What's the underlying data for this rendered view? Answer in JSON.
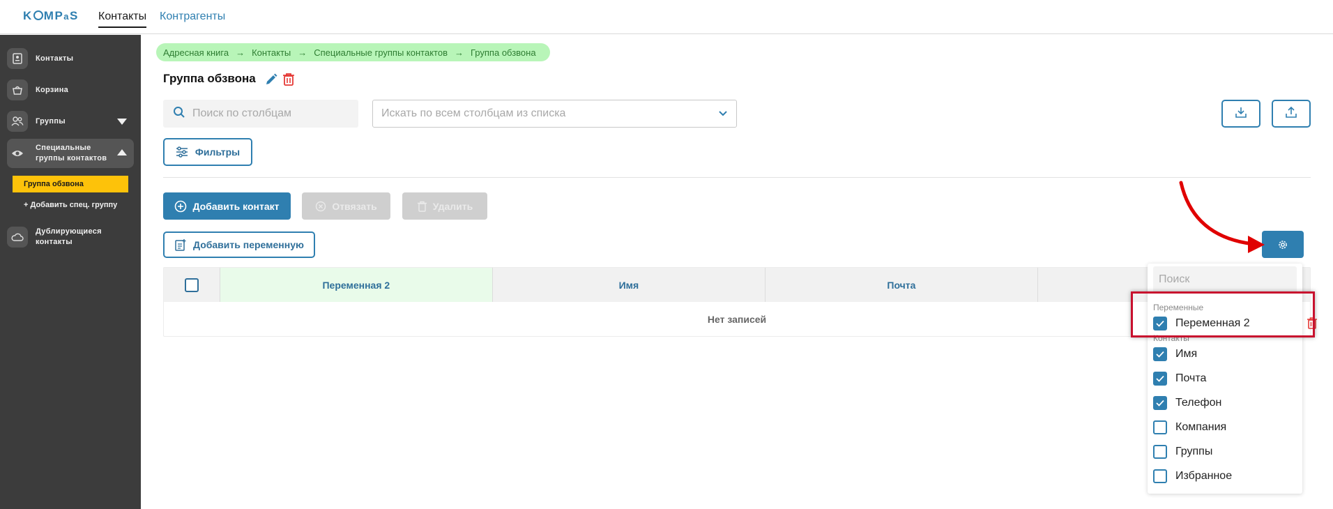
{
  "app": {
    "logo": "KOMPAS",
    "top_tabs": [
      {
        "label": "Контакты",
        "active": true
      },
      {
        "label": "Контрагенты",
        "active": false
      }
    ]
  },
  "sidebar": {
    "items": [
      {
        "label": "Контакты",
        "icon": "contact-card-icon"
      },
      {
        "label": "Корзина",
        "icon": "basket-icon"
      },
      {
        "label": "Группы",
        "icon": "users-icon"
      },
      {
        "label": "Специальные группы контактов",
        "icon": "eye-icon"
      },
      {
        "label": "Дублирующиеся контакты",
        "icon": "cloud-icon"
      }
    ],
    "sub_active": "Группа обзвона",
    "sub_add": "+ Добавить спец. группу"
  },
  "breadcrumb": [
    "Адресная книга",
    "Контакты",
    "Специальные группы контактов",
    "Группа обзвона"
  ],
  "page_title": "Группа обзвона",
  "search": {
    "columns_placeholder": "Поиск по столбцам",
    "all_placeholder": "Искать по всем столбцам из списка"
  },
  "buttons": {
    "filters": "Фильтры",
    "add_contact": "Добавить контакт",
    "unlink": "Отвязать",
    "delete": "Удалить",
    "add_variable": "Добавить переменную"
  },
  "table": {
    "columns": [
      "Переменная 2",
      "Имя",
      "Почта",
      ""
    ],
    "empty_text": "Нет записей"
  },
  "column_panel": {
    "search_placeholder": "Поиск",
    "groups": [
      {
        "label": "Переменные",
        "options": [
          {
            "label": "Переменная 2",
            "checked": true
          }
        ]
      },
      {
        "label": "Контакты",
        "options": [
          {
            "label": "Имя",
            "checked": true
          },
          {
            "label": "Почта",
            "checked": true
          },
          {
            "label": "Телефон",
            "checked": true
          },
          {
            "label": "Компания",
            "checked": false
          },
          {
            "label": "Группы",
            "checked": false
          },
          {
            "label": "Избранное",
            "checked": false
          }
        ]
      }
    ]
  },
  "colors": {
    "accent": "#2f7fb0",
    "sidebar": "#3c3c3c",
    "active_sub": "#fdc20a",
    "breadcrumb_bg": "#b8f5b8",
    "annotation": "#c8102e"
  }
}
